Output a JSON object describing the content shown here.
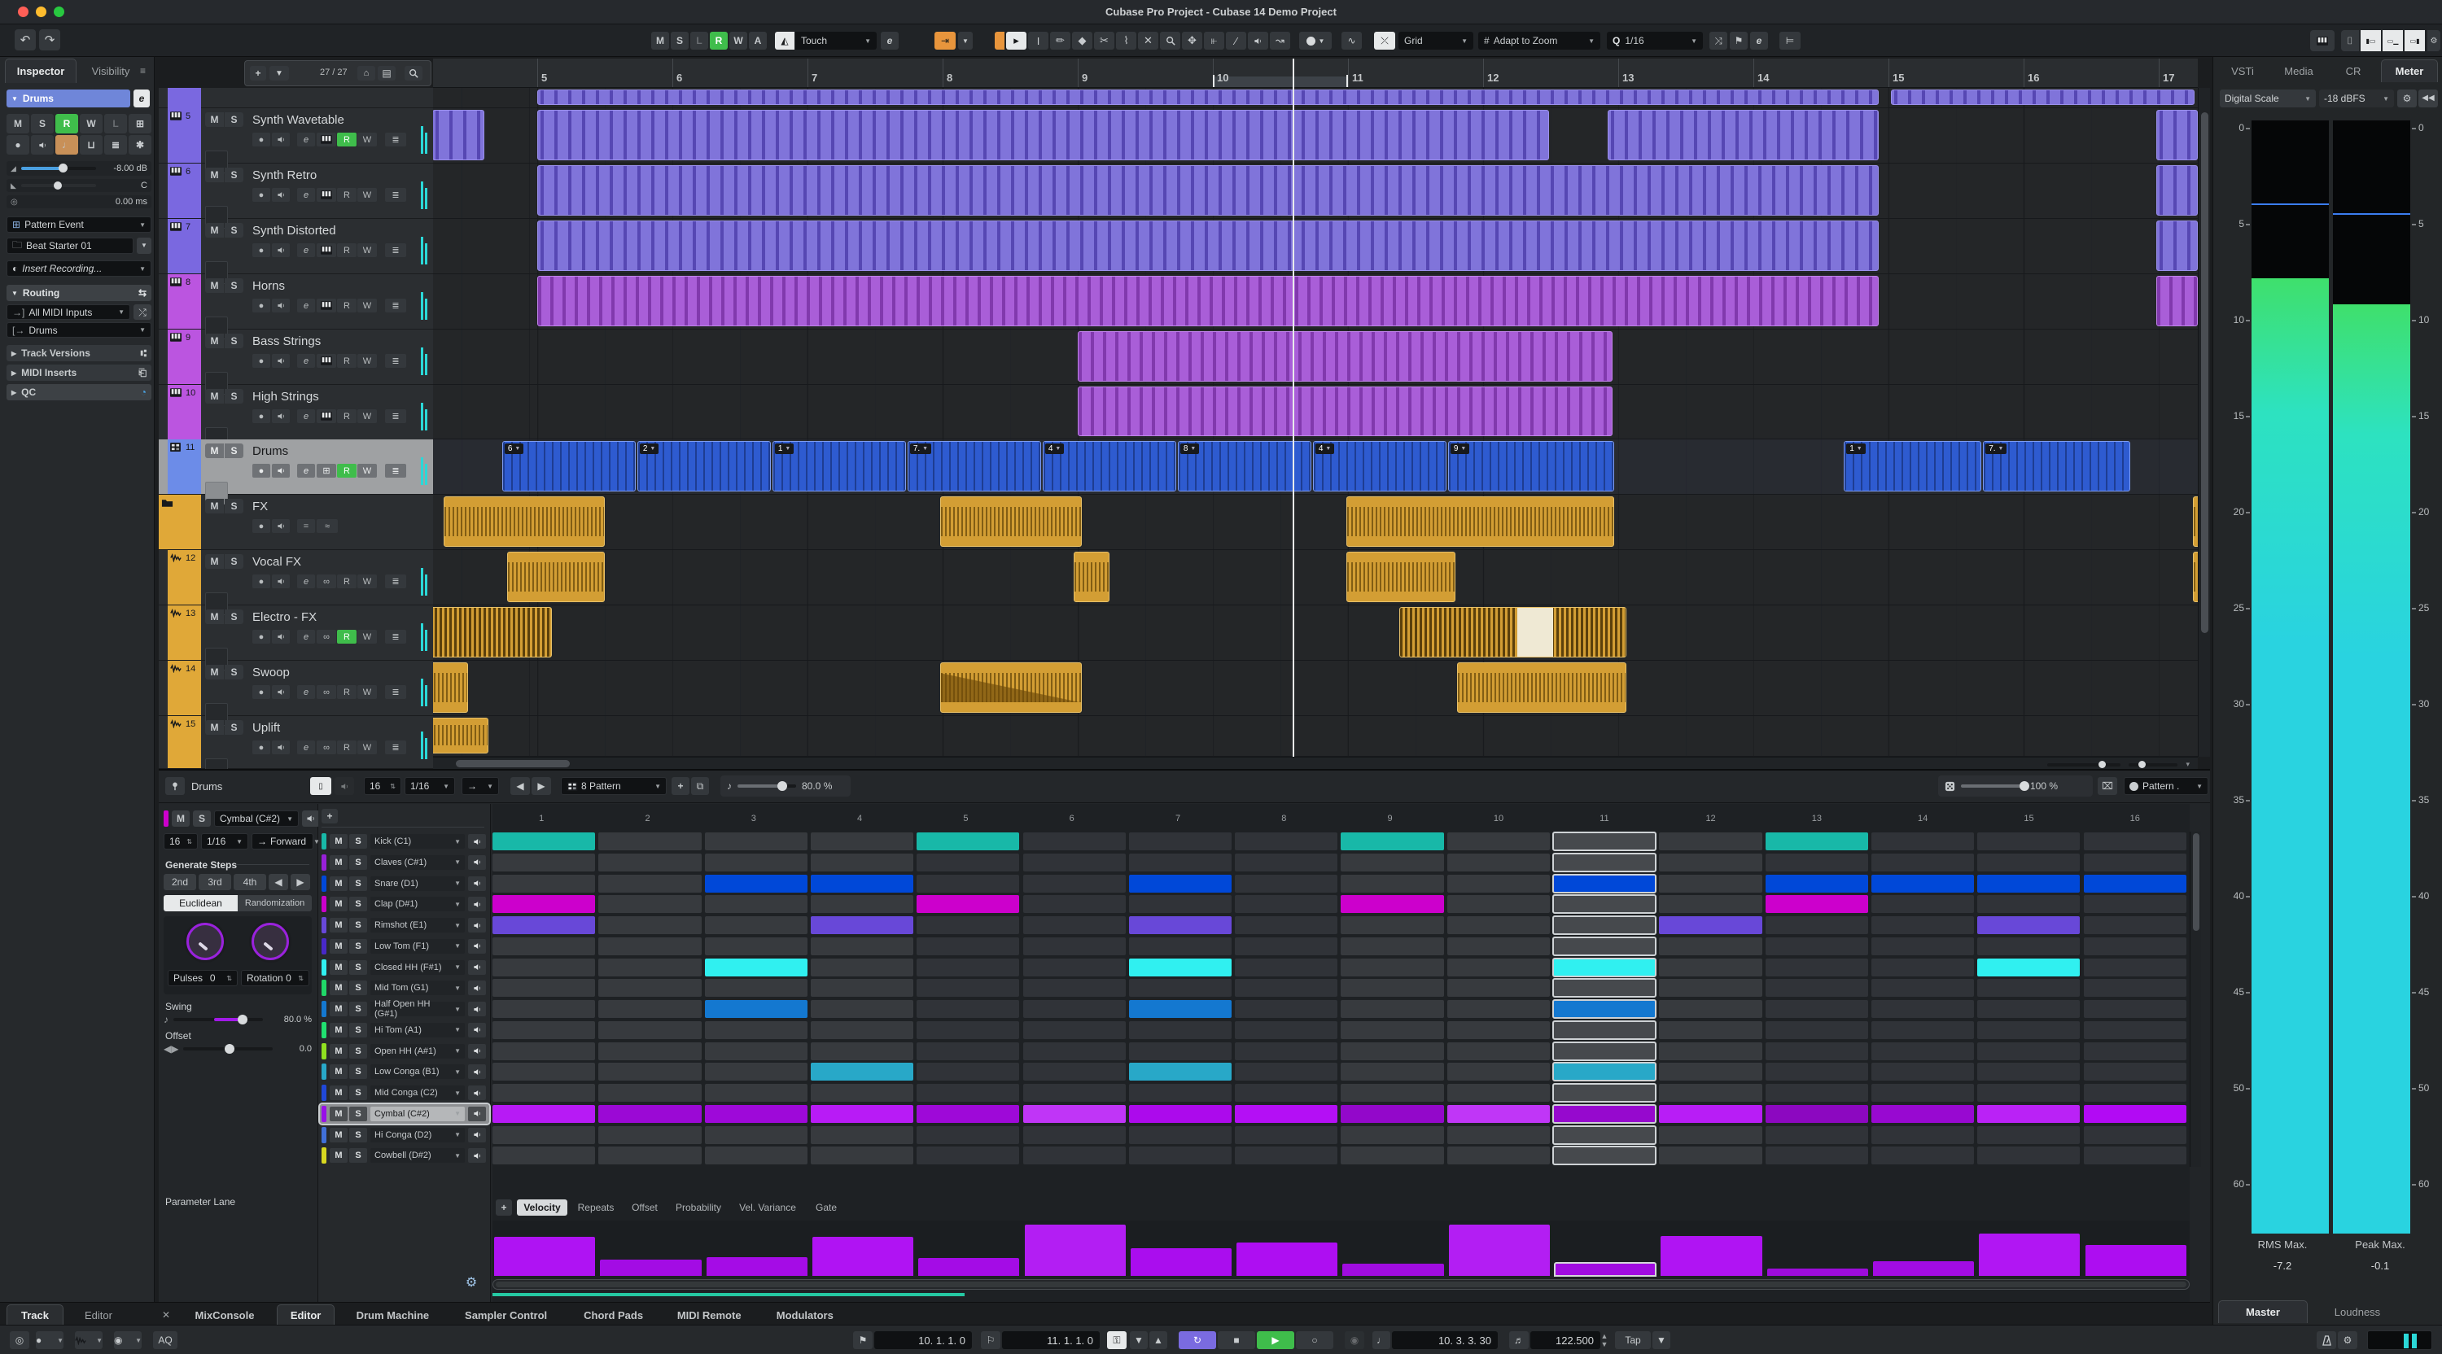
{
  "window": {
    "title": "Cubase Pro Project - Cubase 14 Demo Project"
  },
  "toolbar": {
    "automation": [
      "M",
      "S",
      "L",
      "R",
      "W",
      "A"
    ],
    "touch": "Touch",
    "grid": "Grid",
    "adapt": "Adapt to Zoom",
    "quantize": "1/16"
  },
  "inspector": {
    "tabs": [
      "Inspector",
      "Visibility"
    ],
    "track": "Drums",
    "volume": "-8.00 dB",
    "pan": "C",
    "delay": "0.00 ms",
    "pattern_event": "Pattern Event",
    "preset": "Beat Starter 01",
    "insert_recording": "Insert Recording...",
    "routing": "Routing",
    "midi_input": "All MIDI Inputs",
    "midi_output": "Drums",
    "sections": [
      "Track Versions",
      "MIDI Inserts",
      "QC"
    ]
  },
  "track_header": {
    "count": "27 / 27"
  },
  "tracks": [
    {
      "num": "5",
      "name": "Synth Wavetable",
      "type": "inst",
      "color": "#7a68e0",
      "rec": true
    },
    {
      "num": "6",
      "name": "Synth Retro",
      "type": "inst",
      "color": "#7a68e0",
      "rec": false
    },
    {
      "num": "7",
      "name": "Synth Distorted",
      "type": "inst",
      "color": "#7a68e0",
      "rec": false
    },
    {
      "num": "8",
      "name": "Horns",
      "type": "inst",
      "color": "#bb55e0",
      "rec": false
    },
    {
      "num": "9",
      "name": "Bass Strings",
      "type": "inst",
      "color": "#bb55e0",
      "rec": false
    },
    {
      "num": "10",
      "name": "High Strings",
      "type": "inst",
      "color": "#bb55e0",
      "rec": false
    },
    {
      "num": "11",
      "name": "Drums",
      "type": "drum",
      "color": "#6c8ce8",
      "rec": true,
      "selected": true
    },
    {
      "num": "",
      "name": "FX",
      "type": "folder",
      "color": "#e0a838",
      "rec": false
    },
    {
      "num": "12",
      "name": "Vocal FX",
      "type": "audio",
      "color": "#e0a838",
      "rec": false
    },
    {
      "num": "13",
      "name": "Electro - FX",
      "type": "audio",
      "color": "#e0a838",
      "rec": true
    },
    {
      "num": "14",
      "name": "Swoop",
      "type": "audio",
      "color": "#e0a838",
      "rec": false
    },
    {
      "num": "15",
      "name": "Uplift",
      "type": "audio",
      "color": "#e0a838",
      "rec": false
    }
  ],
  "arrangement": {
    "ruler_bars": [
      5,
      6,
      7,
      8,
      9,
      10,
      11,
      12,
      13,
      14,
      15,
      16,
      17
    ],
    "cycle": {
      "start": 10,
      "end": 11
    },
    "playhead_bar": 10.62,
    "clips": [
      {
        "lane": 0,
        "s": 5,
        "e": 14.94,
        "kind": "synth"
      },
      {
        "lane": 0,
        "s": 15.02,
        "e": 17.28,
        "kind": "synth"
      },
      {
        "lane": 1,
        "s": 4.22,
        "e": 4.62,
        "kind": "synth"
      },
      {
        "lane": 1,
        "s": 5,
        "e": 12.5,
        "kind": "synth"
      },
      {
        "lane": 1,
        "s": 12.92,
        "e": 14.94,
        "kind": "synth"
      },
      {
        "lane": 1,
        "s": 16.98,
        "e": 17.3,
        "kind": "synth"
      },
      {
        "lane": 2,
        "s": 5,
        "e": 14.94,
        "kind": "synth"
      },
      {
        "lane": 2,
        "s": 16.98,
        "e": 17.3,
        "kind": "synth"
      },
      {
        "lane": 3,
        "s": 5,
        "e": 14.94,
        "kind": "synth"
      },
      {
        "lane": 3,
        "s": 16.98,
        "e": 17.3,
        "kind": "synth"
      },
      {
        "lane": 4,
        "s": 5,
        "e": 14.94,
        "kind": "horn"
      },
      {
        "lane": 4,
        "s": 16.98,
        "e": 17.3,
        "kind": "horn"
      },
      {
        "lane": 5,
        "s": 9,
        "e": 12.97,
        "kind": "horn"
      },
      {
        "lane": 6,
        "s": 9,
        "e": 12.97,
        "kind": "horn"
      },
      {
        "lane": 7,
        "s": 4.74,
        "e": 5.74,
        "kind": "drum",
        "label": "6"
      },
      {
        "lane": 7,
        "s": 5.74,
        "e": 6.74,
        "kind": "drum",
        "label": "2"
      },
      {
        "lane": 7,
        "s": 6.74,
        "e": 7.74,
        "kind": "drum",
        "label": "1"
      },
      {
        "lane": 7,
        "s": 7.74,
        "e": 8.74,
        "kind": "drum",
        "label": "7."
      },
      {
        "lane": 7,
        "s": 8.74,
        "e": 9.74,
        "kind": "drum",
        "label": "4"
      },
      {
        "lane": 7,
        "s": 9.74,
        "e": 10.74,
        "kind": "drum",
        "label": "8"
      },
      {
        "lane": 7,
        "s": 10.74,
        "e": 11.74,
        "kind": "drum",
        "label": "4"
      },
      {
        "lane": 7,
        "s": 11.74,
        "e": 12.98,
        "kind": "drum",
        "label": "9"
      },
      {
        "lane": 7,
        "s": 14.67,
        "e": 15.7,
        "kind": "drum",
        "label": "1"
      },
      {
        "lane": 7,
        "s": 15.7,
        "e": 16.8,
        "kind": "drum",
        "label": "7."
      },
      {
        "lane": 8,
        "s": 4.31,
        "e": 5.51,
        "kind": "audio"
      },
      {
        "lane": 8,
        "s": 7.98,
        "e": 9.04,
        "kind": "audio"
      },
      {
        "lane": 8,
        "s": 10.99,
        "e": 12.98,
        "kind": "audio"
      },
      {
        "lane": 8,
        "s": 17.25,
        "e": 17.34,
        "kind": "audio"
      },
      {
        "lane": 9,
        "s": 4.78,
        "e": 5.51,
        "kind": "audio"
      },
      {
        "lane": 9,
        "s": 8.97,
        "e": 9.25,
        "kind": "audio"
      },
      {
        "lane": 9,
        "s": 10.99,
        "e": 11.81,
        "kind": "audio"
      },
      {
        "lane": 9,
        "s": 17.25,
        "e": 17.34,
        "kind": "audio"
      },
      {
        "lane": 10,
        "s": 4.2,
        "e": 5.12,
        "kind": "stripe"
      },
      {
        "lane": 10,
        "s": 11.38,
        "e": 13.07,
        "kind": "stripe",
        "white": true
      },
      {
        "lane": 11,
        "s": 4.2,
        "e": 4.5,
        "kind": "audio"
      },
      {
        "lane": 11,
        "s": 7.98,
        "e": 9.04,
        "kind": "fade"
      },
      {
        "lane": 11,
        "s": 11.81,
        "e": 13.07,
        "kind": "audio"
      },
      {
        "lane": 12,
        "s": 4.2,
        "e": 4.65,
        "kind": "audio"
      }
    ]
  },
  "editor": {
    "toolbar": {
      "track": "Drums",
      "steps": "16",
      "res": "1/16",
      "pattern": "8 Pattern",
      "swing": "80.0 %",
      "random": "100 %",
      "tool": "Pattern ."
    },
    "left": {
      "sel": "Cymbal (C#2)",
      "steps": "16",
      "res": "1/16",
      "dir": "Forward",
      "gen": "Generate Steps",
      "every": [
        "2nd",
        "3rd",
        "4th"
      ],
      "modes": [
        "Euclidean",
        "Randomization"
      ],
      "mode_active": "Euclidean",
      "pulses_label": "Pulses",
      "pulses": "0",
      "rotation_label": "Rotation",
      "rotation": "0",
      "swing_label": "Swing",
      "swing": "80.0 %",
      "offset_label": "Offset",
      "offset": "0.0"
    },
    "step_count": 16,
    "current_step": 11,
    "columns": [
      1,
      2,
      3,
      4,
      5,
      6,
      7,
      8,
      9,
      10,
      11,
      12,
      13,
      14,
      15,
      16
    ],
    "rows": [
      {
        "name": "Kick (C1)",
        "color": "#18b8a8",
        "steps": [
          1,
          5,
          9,
          13
        ]
      },
      {
        "name": "Claves (C#1)",
        "color": "#9820d8",
        "steps": []
      },
      {
        "name": "Snare (D1)",
        "color": "#0048d8",
        "steps": [
          3,
          4,
          7,
          11,
          13,
          14,
          15,
          16
        ]
      },
      {
        "name": "Clap (D#1)",
        "color": "#cc00cc",
        "steps": [
          1,
          5,
          9,
          13
        ]
      },
      {
        "name": "Rimshot (E1)",
        "color": "#6848d8",
        "steps": [
          1,
          4,
          7,
          12,
          15
        ]
      },
      {
        "name": "Low Tom (F1)",
        "color": "#4828c8",
        "steps": []
      },
      {
        "name": "Closed HH (F#1)",
        "color": "#30f0f0",
        "steps": [
          3,
          7,
          11,
          15
        ]
      },
      {
        "name": "Mid Tom (G1)",
        "color": "#20d868",
        "steps": []
      },
      {
        "name": "Half Open HH (G#1)",
        "color": "#1478d0",
        "steps": [
          3,
          7,
          11
        ]
      },
      {
        "name": "Hi Tom (A1)",
        "color": "#20e070",
        "steps": []
      },
      {
        "name": "Open HH (A#1)",
        "color": "#90e020",
        "steps": []
      },
      {
        "name": "Low Conga (B1)",
        "color": "#28a8c8",
        "steps": [
          4,
          7,
          11
        ]
      },
      {
        "name": "Mid Conga (C2)",
        "color": "#2048d8",
        "steps": []
      },
      {
        "name": "Cymbal (C#2)",
        "color": "#9810e8",
        "steps": [
          1,
          2,
          3,
          4,
          5,
          6,
          7,
          8,
          9,
          10,
          11,
          12,
          13,
          14,
          15,
          16
        ],
        "selected": true
      },
      {
        "name": "Hi Conga (D2)",
        "color": "#4070d8",
        "steps": []
      },
      {
        "name": "Cowbell (D#2)",
        "color": "#d8d820",
        "steps": []
      }
    ],
    "velocities": [
      72,
      31,
      35,
      73,
      34,
      95,
      51,
      62,
      22,
      96,
      25,
      74,
      13,
      28,
      79,
      58
    ],
    "lane": {
      "label": "Parameter Lane",
      "tabs": [
        "Velocity",
        "Repeats",
        "Offset",
        "Probability",
        "Vel. Variance",
        "Gate"
      ],
      "active": "Velocity"
    }
  },
  "right_zone": {
    "tabs": [
      "VSTi",
      "Media",
      "CR",
      "Meter"
    ],
    "active_tab": "Meter",
    "scale": "Digital Scale",
    "reference": "-18 dBFS",
    "ticks": [
      "0",
      "5",
      "10",
      "15",
      "20",
      "25",
      "30",
      "35",
      "40",
      "45",
      "50",
      "60"
    ],
    "rms_label": "RMS Max.",
    "rms": "-7.2",
    "peak_label": "Peak Max.",
    "peak": "-0.1",
    "bottom_tabs": [
      "Master",
      "Loudness"
    ],
    "bottom_active": "Master",
    "meter_color_top": "#3fe06c",
    "meter_color_mid": "#2de2c0",
    "meter_color_low": "#29d3e0",
    "levels": {
      "left_db": -7.0,
      "right_db": -8.3
    }
  },
  "tabs": {
    "left": [
      "Track",
      "Editor"
    ],
    "left_active": "Track",
    "zone": [
      "MixConsole",
      "Editor",
      "Drum Machine",
      "Sampler Control",
      "Chord Pads",
      "MIDI Remote",
      "Modulators"
    ],
    "zone_active": "Editor"
  },
  "transport": {
    "loc_l": "10. 1. 1. 0",
    "loc_r": "11. 1. 1. 0",
    "pos": "10. 3. 3. 30",
    "tempo": "122.500",
    "tap": "Tap",
    "aq": "AQ"
  }
}
